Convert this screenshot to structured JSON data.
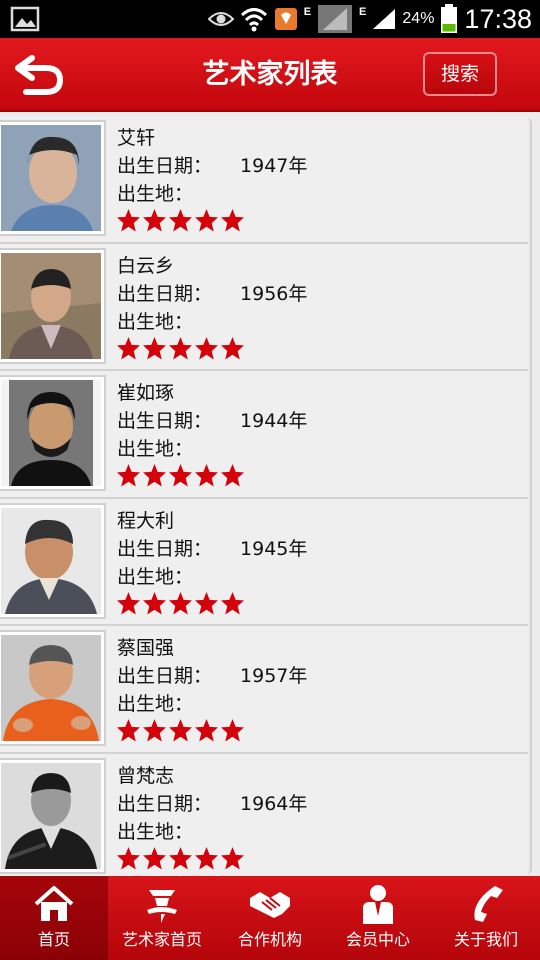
{
  "status_bar": {
    "battery_pct": "24%",
    "time": "17:38",
    "network_label": "E"
  },
  "header": {
    "title": "艺术家列表",
    "search_label": "搜索"
  },
  "labels": {
    "birth_date": "出生日期：",
    "birth_place": "出生地："
  },
  "artists": [
    {
      "name": "艾轩",
      "birth_year": "1947年",
      "birth_place": "",
      "rating": 5
    },
    {
      "name": "白云乡",
      "birth_year": "1956年",
      "birth_place": "",
      "rating": 5
    },
    {
      "name": "崔如琢",
      "birth_year": "1944年",
      "birth_place": "",
      "rating": 5
    },
    {
      "name": "程大利",
      "birth_year": "1945年",
      "birth_place": "",
      "rating": 5
    },
    {
      "name": "蔡国强",
      "birth_year": "1957年",
      "birth_place": "",
      "rating": 5
    },
    {
      "name": "曾梵志",
      "birth_year": "1964年",
      "birth_place": "",
      "rating": 5
    }
  ],
  "bottom_nav": [
    {
      "label": "首页",
      "icon": "home-icon",
      "active": true
    },
    {
      "label": "艺术家首页",
      "icon": "calligraphy-icon",
      "active": false
    },
    {
      "label": "合作机构",
      "icon": "handshake-icon",
      "active": false
    },
    {
      "label": "会员中心",
      "icon": "member-icon",
      "active": false
    },
    {
      "label": "关于我们",
      "icon": "phone-icon",
      "active": false
    }
  ],
  "colors": {
    "brand_red": "#d0080e",
    "star_red": "#d4000a"
  }
}
